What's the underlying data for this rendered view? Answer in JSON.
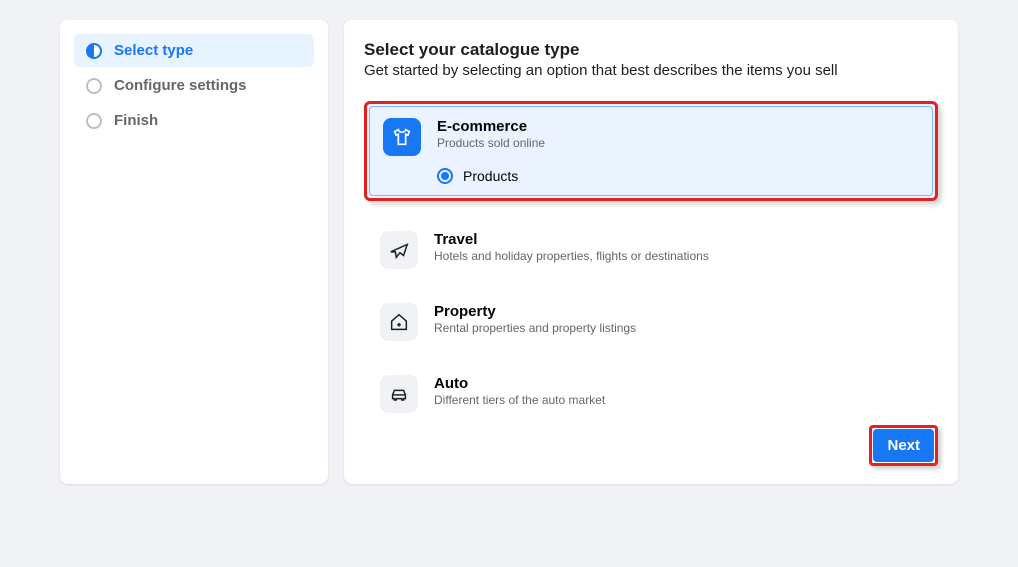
{
  "sidebar": {
    "steps": [
      {
        "label": "Select type",
        "active": true
      },
      {
        "label": "Configure settings",
        "active": false
      },
      {
        "label": "Finish",
        "active": false
      }
    ]
  },
  "header": {
    "title": "Select your catalogue type",
    "subtitle": "Get started by selecting an option that best describes the items you sell"
  },
  "options": {
    "selected": {
      "icon": "shirt-icon",
      "title": "E-commerce",
      "desc": "Products sold online",
      "subopt": "Products"
    },
    "list": [
      {
        "icon": "plane-icon",
        "title": "Travel",
        "desc": "Hotels and holiday properties, flights or destinations"
      },
      {
        "icon": "house-icon",
        "title": "Property",
        "desc": "Rental properties and property listings"
      },
      {
        "icon": "car-icon",
        "title": "Auto",
        "desc": "Different tiers of the auto market"
      }
    ]
  },
  "buttons": {
    "next": "Next"
  }
}
